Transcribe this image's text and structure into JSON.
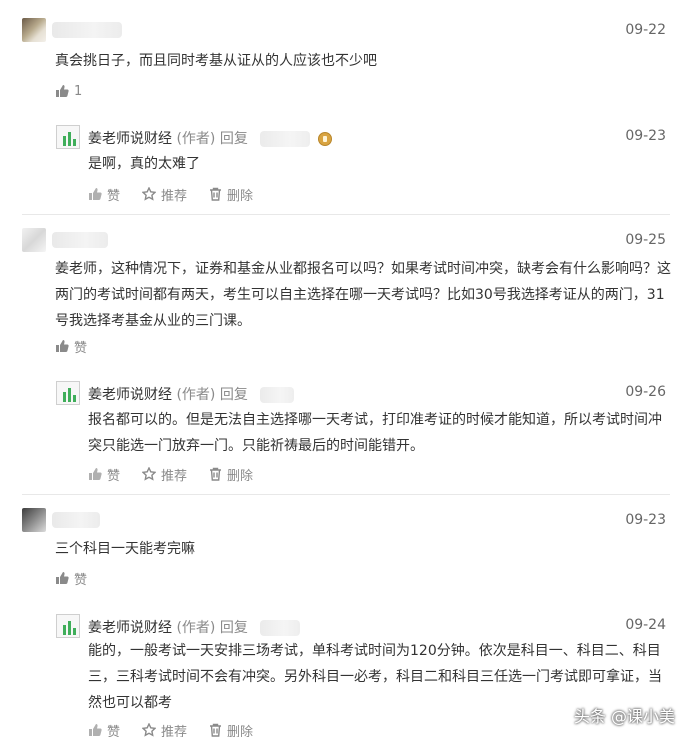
{
  "comments": [
    {
      "date": "09-22",
      "text": "真会挑日子，而且同时考基从证从的人应该也不少吧",
      "like_count": "1",
      "reply": {
        "author": "姜老师说财经",
        "tag": "(作者)",
        "verb": "回复",
        "date": "09-23",
        "text": "是啊，真的太难了",
        "like": "赞",
        "recommend": "推荐",
        "delete": "删除"
      }
    },
    {
      "date": "09-25",
      "text": "姜老师，这种情况下，证券和基金从业都报名可以吗？如果考试时间冲突，缺考会有什么影响吗？这两门的考试时间都有两天，考生可以自主选择在哪一天考试吗？比如30号我选择考证从的两门，31号我选择考基金从业的三门课。",
      "like": "赞",
      "reply": {
        "author": "姜老师说财经",
        "tag": "(作者)",
        "verb": "回复",
        "date": "09-26",
        "text": "报名都可以的。但是无法自主选择哪一天考试，打印准考证的时候才能知道，所以考试时间冲突只能选一门放弃一门。只能祈祷最后的时间能错开。",
        "like": "赞",
        "recommend": "推荐",
        "delete": "删除"
      }
    },
    {
      "date": "09-23",
      "text": "三个科目一天能考完嘛",
      "like": "赞",
      "reply": {
        "author": "姜老师说财经",
        "tag": "(作者)",
        "verb": "回复",
        "date": "09-24",
        "text": "能的，一般考试一天安排三场考试，单科考试时间为120分钟。依次是科目一、科目二、科目三，三科考试时间不会有冲突。另外科目一必考，科目二和科目三任选一门考试即可拿证，当然也可以都考",
        "like": "赞",
        "recommend": "推荐",
        "delete": "删除"
      }
    }
  ],
  "watermark": "头条 @课小美",
  "colors": {
    "text": "#333333",
    "muted": "#8a8a8a",
    "date": "#666666",
    "divider": "#e8e8e8"
  },
  "icons": [
    "thumbs-up-icon",
    "star-icon",
    "trash-icon",
    "author-badge-icon"
  ]
}
